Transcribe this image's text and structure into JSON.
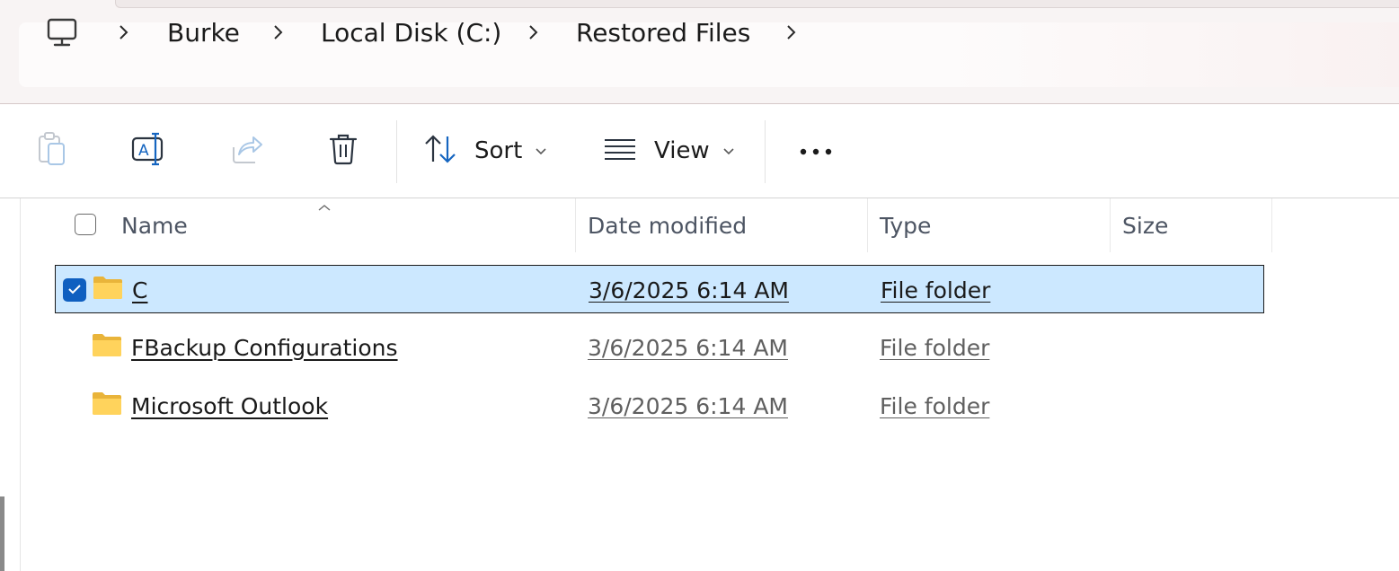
{
  "breadcrumb": {
    "items": [
      "Burke",
      "Local Disk (C:)",
      "Restored Files"
    ]
  },
  "toolbar": {
    "sort_label": "Sort",
    "view_label": "View"
  },
  "columns": {
    "name": "Name",
    "date_modified": "Date modified",
    "type": "Type",
    "size": "Size"
  },
  "files": [
    {
      "name": "C",
      "date_modified": "3/6/2025 6:14 AM",
      "type": "File folder",
      "size": "",
      "selected": true
    },
    {
      "name": "FBackup Configurations",
      "date_modified": "3/6/2025 6:14 AM",
      "type": "File folder",
      "size": "",
      "selected": false
    },
    {
      "name": "Microsoft Outlook",
      "date_modified": "3/6/2025 6:14 AM",
      "type": "File folder",
      "size": "",
      "selected": false
    }
  ],
  "colors": {
    "accent": "#0f5fc0",
    "selection": "#cce8ff",
    "folder": "#ffcc44"
  },
  "icons": {
    "location": "computer-icon",
    "copy": "clipboard-icon",
    "rename": "rename-icon",
    "share": "share-icon",
    "delete": "trash-icon",
    "sort": "sort-arrows-icon",
    "view": "view-lines-icon",
    "more": "more-dots-icon"
  }
}
